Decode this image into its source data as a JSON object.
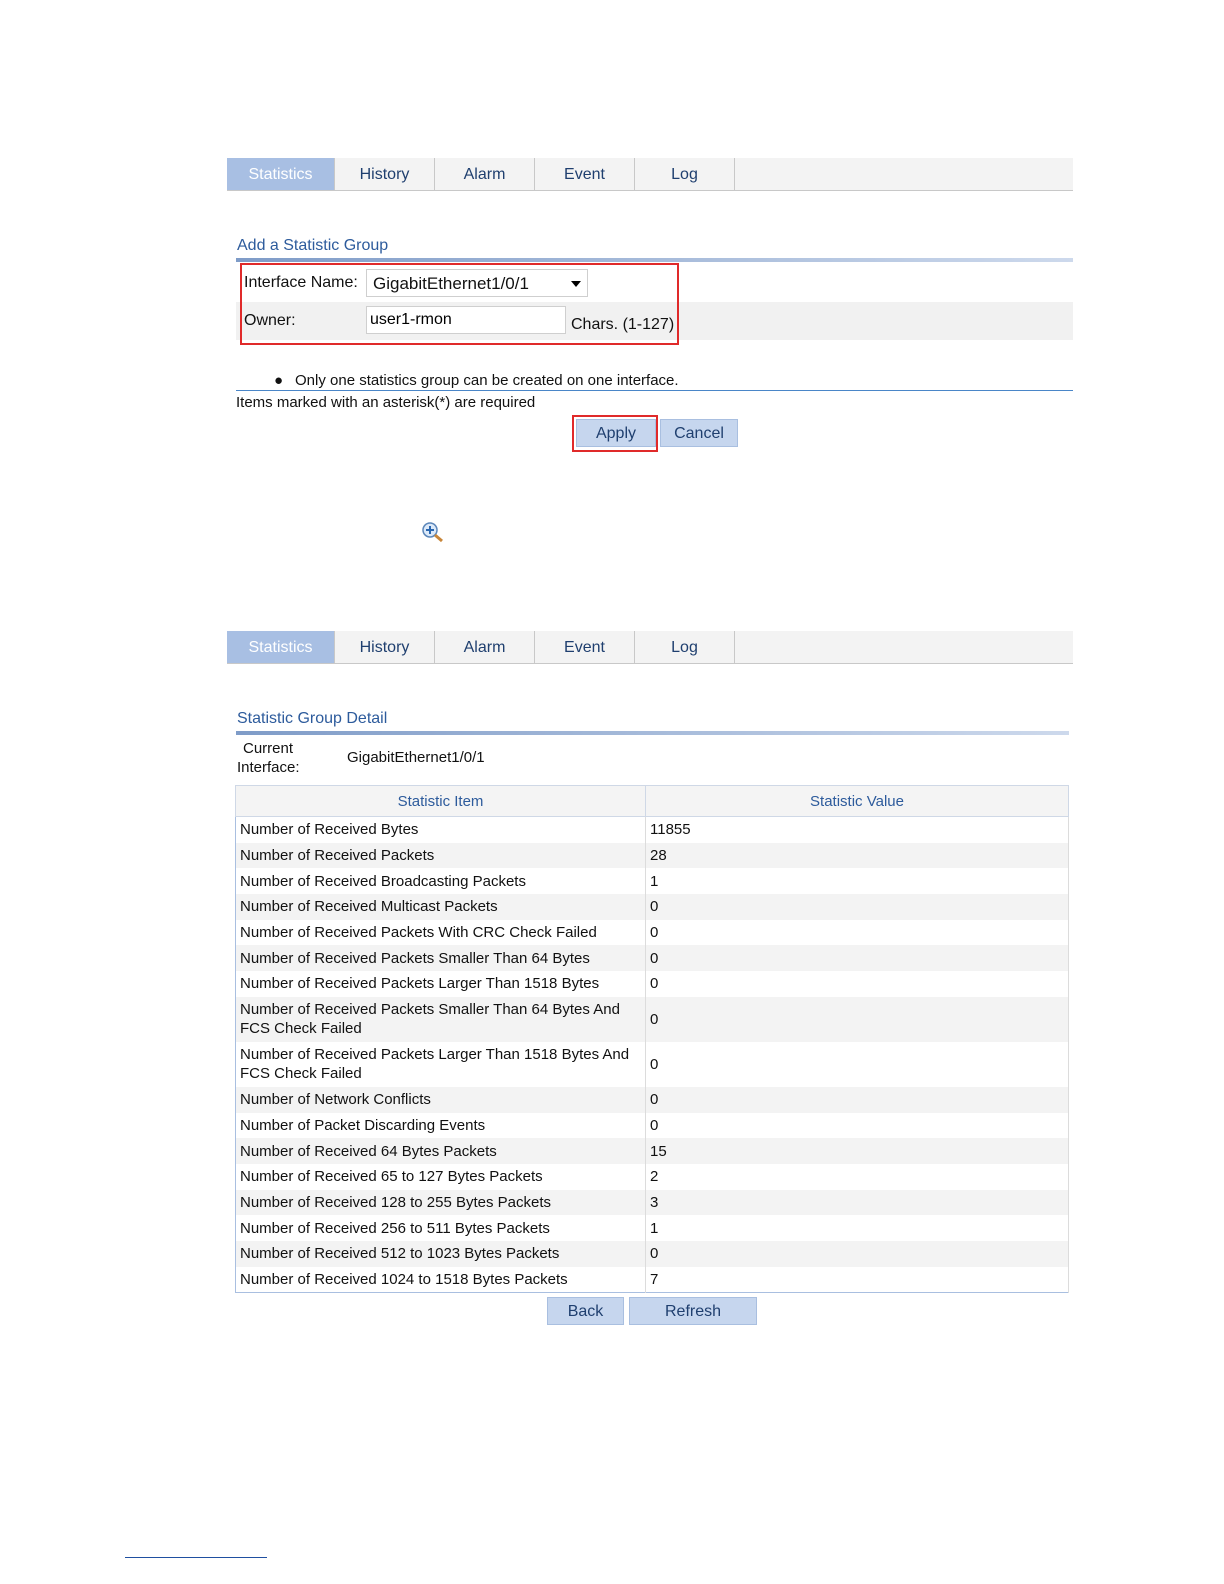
{
  "tabs": [
    "Statistics",
    "History",
    "Alarm",
    "Event",
    "Log"
  ],
  "add_section": {
    "title": "Add a Statistic Group",
    "interface_label": "Interface Name:",
    "interface_value": "GigabitEthernet1/0/1",
    "owner_label": "Owner:",
    "owner_value": "user1-rmon",
    "owner_hint": "Chars. (1-127)",
    "note": "Only one statistics group can be created on one interface.",
    "required_note": "Items marked with an asterisk(*) are required",
    "apply_label": "Apply",
    "cancel_label": "Cancel"
  },
  "zoom_icon": "zoom-in-icon",
  "detail_section": {
    "title": "Statistic Group Detail",
    "current_label_line1": "Current",
    "current_label_line2": "Interface:",
    "current_value": "GigabitEthernet1/0/1",
    "col_item": "Statistic Item",
    "col_value": "Statistic Value",
    "rows": [
      {
        "item": "Number of Received Bytes",
        "value": "11855"
      },
      {
        "item": "Number of Received Packets",
        "value": "28"
      },
      {
        "item": "Number of Received Broadcasting Packets",
        "value": "1"
      },
      {
        "item": "Number of Received Multicast Packets",
        "value": "0"
      },
      {
        "item": "Number of Received Packets With CRC Check Failed",
        "value": "0"
      },
      {
        "item": "Number of Received Packets Smaller Than 64 Bytes",
        "value": "0"
      },
      {
        "item": "Number of Received Packets Larger Than 1518 Bytes",
        "value": "0"
      },
      {
        "item": "Number of Received Packets Smaller Than 64 Bytes And FCS Check Failed",
        "value": "0"
      },
      {
        "item": "Number of Received Packets Larger Than 1518 Bytes And FCS Check Failed",
        "value": "0"
      },
      {
        "item": "Number of Network Conflicts",
        "value": "0"
      },
      {
        "item": "Number of Packet Discarding Events",
        "value": "0"
      },
      {
        "item": "Number of Received 64 Bytes Packets",
        "value": "15"
      },
      {
        "item": "Number of Received 65 to 127 Bytes Packets",
        "value": "2"
      },
      {
        "item": "Number of Received 128 to 255 Bytes Packets",
        "value": "3"
      },
      {
        "item": "Number of Received 256 to 511 Bytes Packets",
        "value": "1"
      },
      {
        "item": "Number of Received 512 to 1023 Bytes Packets",
        "value": "0"
      },
      {
        "item": "Number of Received 1024 to 1518 Bytes Packets",
        "value": "7"
      }
    ],
    "back_label": "Back",
    "refresh_label": "Refresh"
  }
}
